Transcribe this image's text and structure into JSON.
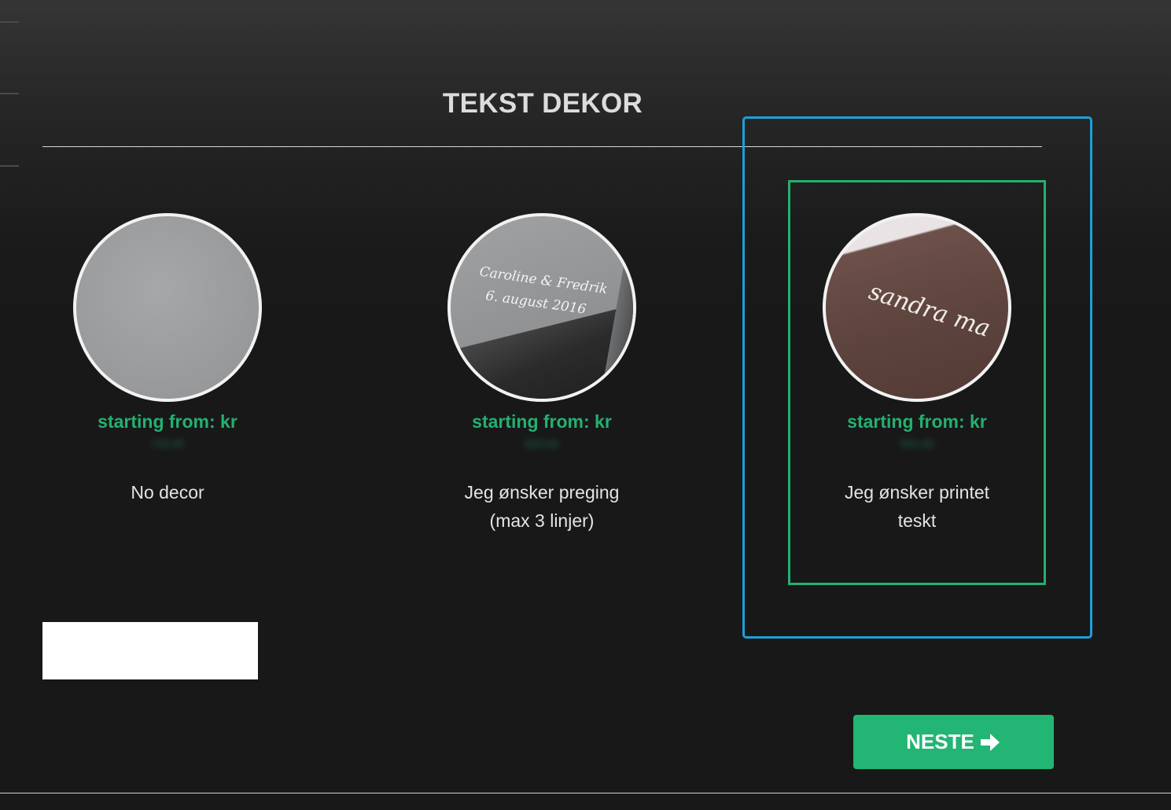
{
  "section": {
    "title": "TEKST DEKOR"
  },
  "options": [
    {
      "price_label": "starting from: kr",
      "price_value": "715,00",
      "name_line1": "No decor",
      "name_line2": ""
    },
    {
      "price_label": "starting from: kr",
      "price_value": "825,00",
      "name_line1": "Jeg ønsker preging",
      "name_line2": "(max 3 linjer)",
      "image_text_line1": "Caroline & Fredrik",
      "image_text_line2": "6. august 2016"
    },
    {
      "price_label": "starting from: kr",
      "price_value": "551,00",
      "name_line1": "Jeg ønsker printet",
      "name_line2": "teskt",
      "image_text": "sandra ma"
    }
  ],
  "next_button": {
    "label": "NESTE",
    "icon": "arrow-right-icon"
  },
  "colors": {
    "accent": "#22b573",
    "selection_outline": "#1e9fd8",
    "background": "#181818"
  }
}
